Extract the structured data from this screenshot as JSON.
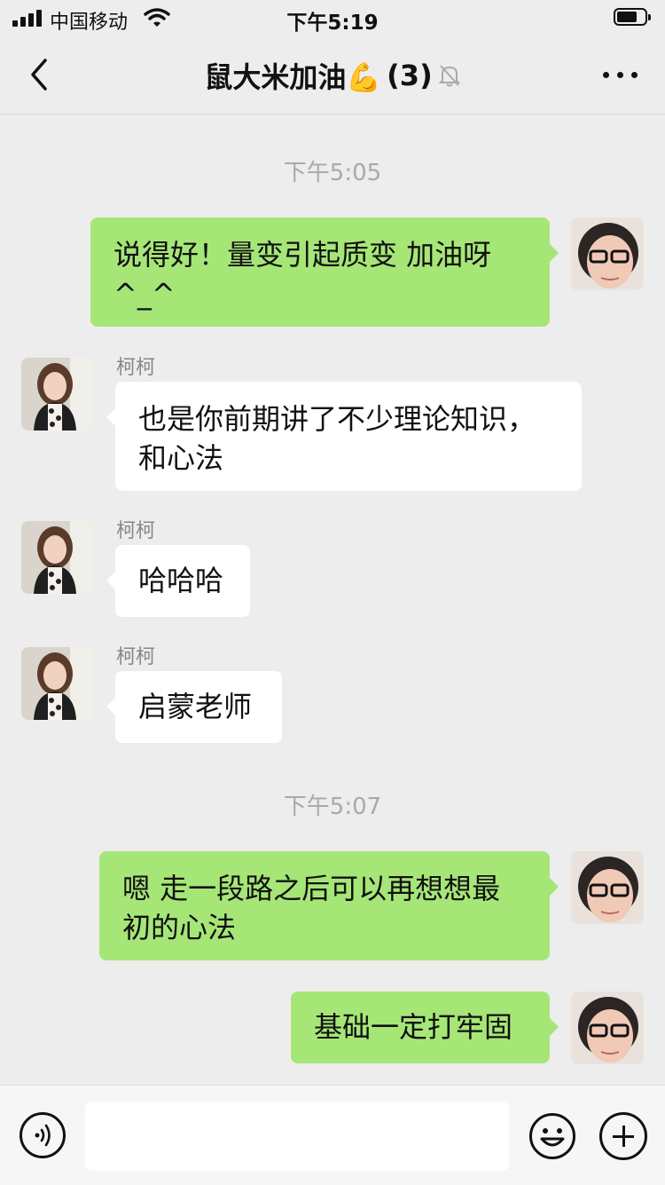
{
  "status_bar": {
    "carrier": "中国移动",
    "time": "下午5:19"
  },
  "header": {
    "title": "鼠大米加油💪",
    "member_count": "(3)",
    "muted_icon": "bell-muted-icon",
    "back_icon": "chevron-left-icon",
    "more_icon": "more-horizontal-icon"
  },
  "chat": {
    "timestamps": [
      "下午5:05",
      "下午5:07"
    ],
    "messages": [
      {
        "direction": "outgoing",
        "text": "说得好！量变引起质变  加油呀^_^"
      },
      {
        "direction": "incoming",
        "sender": "柯柯",
        "text": "也是你前期讲了不少理论知识，和心法"
      },
      {
        "direction": "incoming",
        "sender": "柯柯",
        "text": "哈哈哈"
      },
      {
        "direction": "incoming",
        "sender": "柯柯",
        "text": "启蒙老师"
      },
      {
        "direction": "outgoing",
        "text": "嗯 走一段路之后可以再想想最初的心法"
      },
      {
        "direction": "outgoing",
        "text": "基础一定打牢固"
      }
    ]
  },
  "input_bar": {
    "voice_icon": "voice-icon",
    "message_placeholder": "",
    "emoji_icon": "emoji-icon",
    "plus_icon": "plus-icon"
  },
  "colors": {
    "outgoing_bubble": "#a6e677",
    "incoming_bubble": "#ffffff",
    "background": "#ededed"
  }
}
